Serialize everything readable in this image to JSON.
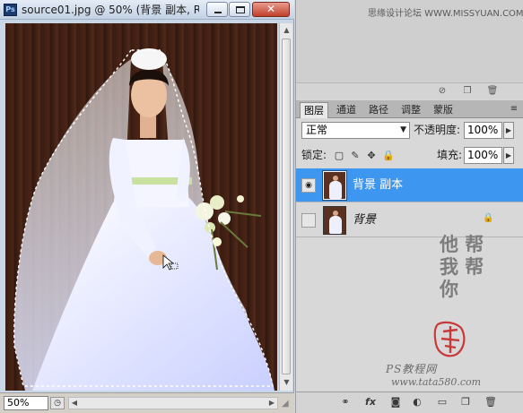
{
  "document": {
    "app_icon": "Ps",
    "title": "source01.jpg @ 50% (背景 副本, R...",
    "window_buttons": {
      "minimize": "minimize-icon",
      "maximize": "maximize-icon",
      "close": "✕"
    },
    "zoom": "50%",
    "status_menu_icon": "status-menu-icon",
    "scroll_arrows": {
      "up": "▲",
      "down": "▼",
      "left": "◀",
      "right": "▶"
    }
  },
  "watermark_top": "思缘设计论坛 WWW.MISSYUAN.COM",
  "layers_panel": {
    "tabs": [
      {
        "label": "图层",
        "active": true
      },
      {
        "label": "通道",
        "active": false
      },
      {
        "label": "路径",
        "active": false
      },
      {
        "label": "调整",
        "active": false
      },
      {
        "label": "蒙版",
        "active": false
      }
    ],
    "blend_mode": "正常",
    "opacity_label": "不透明度:",
    "opacity_value": "100%",
    "lock_label": "锁定:",
    "fill_label": "填充:",
    "fill_value": "100%",
    "layers": [
      {
        "name": "背景 副本",
        "visible": true,
        "selected": true,
        "locked": false
      },
      {
        "name": "背景",
        "visible": false,
        "selected": false,
        "locked": true
      }
    ],
    "footer_icons": [
      "link-icon",
      "fx-icon",
      "mask-icon",
      "adjustment-icon",
      "group-icon",
      "new-layer-icon",
      "trash-icon"
    ]
  },
  "watermark_signature": {
    "calligraphy": "他 帮 我 帮 你",
    "credit_line1": "PS教程网",
    "credit_line2": "www.tata580.com"
  },
  "colors": {
    "selection": "#3d96f0",
    "titlebar": "#c3d1e3",
    "canvas_background": "#3a1c12"
  }
}
